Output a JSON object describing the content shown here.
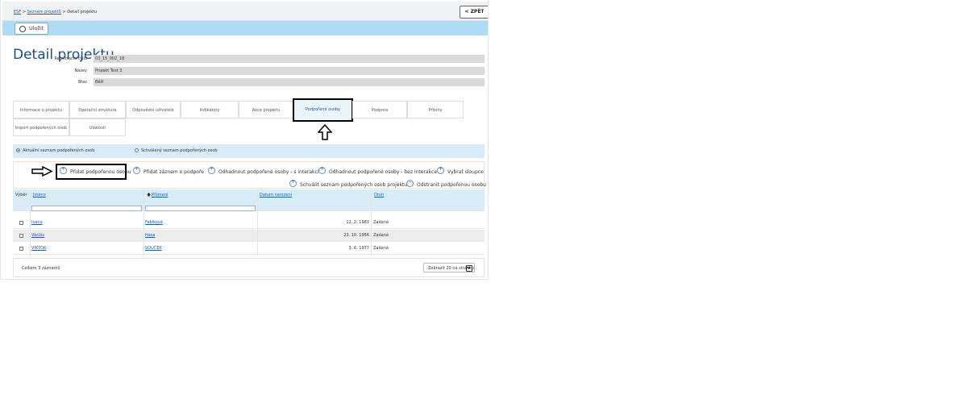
{
  "breadcrumb": {
    "root": "ESF",
    "list": "Seznam projektů",
    "current": "Detail projektu",
    "sep": ">"
  },
  "header": {
    "back_label": "< ZPĚT"
  },
  "toolbar": {
    "save_label": "Uložit"
  },
  "page": {
    "title": "Detail projektu"
  },
  "fields": [
    {
      "label": "Registrační číslo",
      "value": "03_15_002_18"
    },
    {
      "label": "Název",
      "value": "Projekt Test 3"
    },
    {
      "label": "Stav",
      "value": "Běží"
    }
  ],
  "tabs": [
    "Informace o projektu",
    "Operační struktura",
    "Odpovědní uživatelé",
    "Indikátory",
    "Akce projektu",
    "Podpořené osoby",
    "Podpora",
    "Přílohy",
    "Import podpořených osob",
    "Události"
  ],
  "active_tab": "Podpořené osoby",
  "radio": {
    "current_label": "Aktuální seznam podpořených osob",
    "approved_label": "Schválený seznam podpořených osob",
    "selected": "current"
  },
  "actions": {
    "add_person": "Přidat podpořenou osobu",
    "add_support_record": "Přidat záznam o podpoře",
    "estimate_with": "Odhadnout podpořené osoby - s interakcí",
    "estimate_without": "Odhadnout podpořené osoby - bez interakce",
    "select_columns": "Vybrat sloupce",
    "approve_list": "Schválit seznam podpořených osob projektu",
    "remove_person": "Odstranit podpořenou osobu"
  },
  "grid": {
    "columns": {
      "select": "Výběr",
      "first_name": "Jméno",
      "last_name": "Příjmení",
      "birth_date": "Datum narození",
      "type": "Druh"
    },
    "sort_arrow": "🡅",
    "rows": [
      {
        "first_name": "Ivana",
        "last_name": "Fabiková",
        "birth_date": "12. 2. 1963",
        "type": "Zadaná"
      },
      {
        "first_name": "Václáv",
        "last_name": "Hasa",
        "birth_date": "23. 10. 1956",
        "type": "Zadaná"
      },
      {
        "first_name": "VIKTOR",
        "last_name": "SOUČEK",
        "birth_date": "3. 6. 1977",
        "type": "Zadaná"
      }
    ]
  },
  "footer": {
    "total": "Celkem 3 záznamů",
    "page_size": "Zobrazit 20 na stránku"
  },
  "colors": {
    "toolbar": "#aedcf6",
    "grid_header": "#d8ecf7",
    "title": "#1a4c8a",
    "link": "#1e5ea8"
  }
}
